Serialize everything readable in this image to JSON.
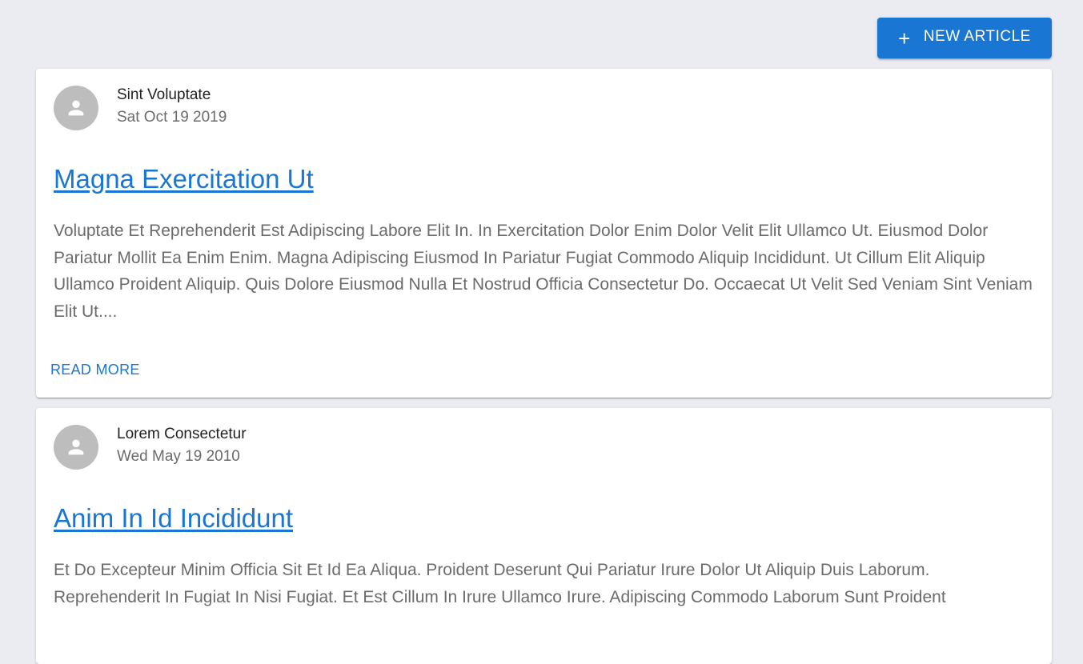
{
  "toolbar": {
    "new_article_label": "NEW ARTICLE",
    "new_article_icon": "plus-icon"
  },
  "articles": [
    {
      "author": "Sint Voluptate",
      "date": "Sat Oct 19 2019",
      "title": "Magna Exercitation Ut",
      "excerpt": "Voluptate Et Reprehenderit Est Adipiscing Labore Elit In. In Exercitation Dolor Enim Dolor Velit Elit Ullamco Ut. Eiusmod Dolor Pariatur Mollit Ea Enim Enim. Magna Adipiscing Eiusmod In Pariatur Fugiat Commodo Aliquip Incididunt. Ut Cillum Elit Aliquip Ullamco Proident Aliquip. Quis Dolore Eiusmod Nulla Et Nostrud Officia Consectetur Do. Occaecat Ut Velit Sed Veniam Sint Veniam Elit Ut....",
      "read_more_label": "READ MORE",
      "avatar_icon": "person-icon"
    },
    {
      "author": "Lorem Consectetur",
      "date": "Wed May 19 2010",
      "title": "Anim In Id Incididunt",
      "excerpt": "Et Do Excepteur Minim Officia Sit Et Id Ea Aliqua. Proident Deserunt Qui Pariatur Irure Dolor Ut Aliquip Duis Laborum. Reprehenderit In Fugiat In Nisi Fugiat. Et Est Cillum In Irure Ullamco Irure. Adipiscing Commodo Laborum Sunt Proident",
      "avatar_icon": "person-icon"
    }
  ],
  "colors": {
    "primary": "#1976d2",
    "background": "#eaecf2",
    "avatar": "#bdbdbd"
  }
}
